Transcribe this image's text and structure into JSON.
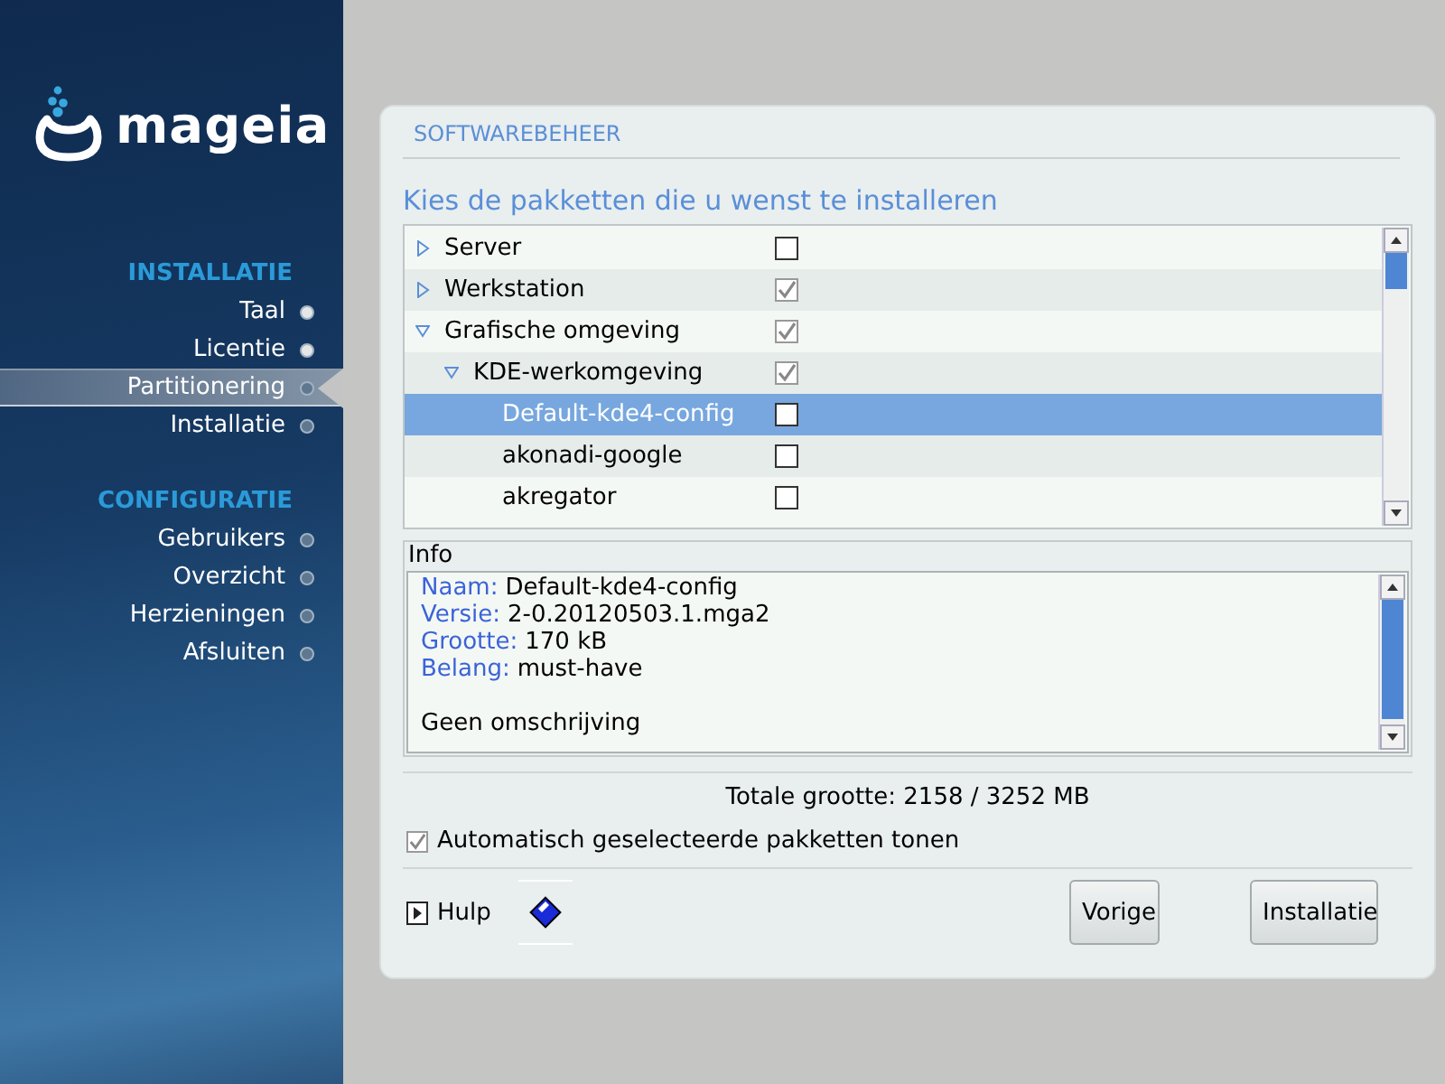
{
  "sidebar": {
    "logo_text": "mageia",
    "sections": [
      {
        "heading": "INSTALLATIE",
        "items": [
          {
            "label": "Taal",
            "done": true,
            "selected": false
          },
          {
            "label": "Licentie",
            "done": true,
            "selected": false
          },
          {
            "label": "Partitionering",
            "done": false,
            "selected": true
          },
          {
            "label": "Installatie",
            "done": false,
            "selected": false
          }
        ]
      },
      {
        "heading": "CONFIGURATIE",
        "items": [
          {
            "label": "Gebruikers",
            "done": false,
            "selected": false
          },
          {
            "label": "Overzicht",
            "done": false,
            "selected": false
          },
          {
            "label": "Herzieningen",
            "done": false,
            "selected": false
          },
          {
            "label": "Afsluiten",
            "done": false,
            "selected": false
          }
        ]
      }
    ]
  },
  "panel": {
    "title": "SOFTWAREBEHEER",
    "subtitle": "Kies de pakketten die u wenst te installeren"
  },
  "package_tree": [
    {
      "label": "Server",
      "checked": false,
      "expanded": false,
      "selected": false
    },
    {
      "label": "Werkstation",
      "checked": true,
      "expanded": false,
      "selected": false
    },
    {
      "label": "Grafische omgeving",
      "checked": true,
      "expanded": true,
      "selected": false,
      "children": [
        {
          "label": "KDE-werkomgeving",
          "checked": true,
          "expanded": true,
          "selected": false,
          "children": [
            {
              "label": "Default-kde4-config",
              "checked": false,
              "selected": true
            },
            {
              "label": "akonadi-google",
              "checked": false,
              "selected": false
            },
            {
              "label": "akregator",
              "checked": false,
              "selected": false
            }
          ]
        }
      ]
    }
  ],
  "info": {
    "title": "Info",
    "fields": [
      {
        "label": "Naam:",
        "value": "Default-kde4-config"
      },
      {
        "label": "Versie:",
        "value": "2-0.20120503.1.mga2"
      },
      {
        "label": "Grootte:",
        "value": "170 kB"
      },
      {
        "label": "Belang:",
        "value": "must-have"
      }
    ],
    "description": "Geen omschrijving"
  },
  "total_size": "Totale grootte: 2158 / 3252 MB",
  "show_auto_selected": {
    "label": "Automatisch geselecteerde pakketten tonen",
    "checked": true
  },
  "help_button": "Hulp",
  "buttons": [
    "Vorige",
    "Installatie"
  ]
}
